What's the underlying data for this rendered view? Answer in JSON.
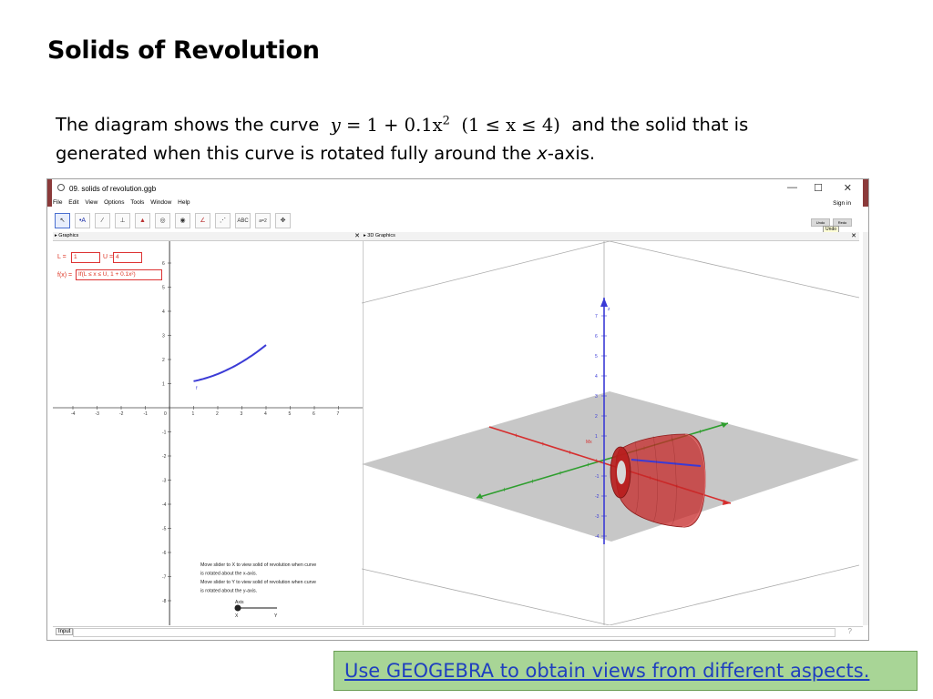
{
  "slide": {
    "title": "Solids of Revolution",
    "desc_before": "The diagram shows the curve",
    "eq_y": "y",
    "eq_main": " = 1 + 0.1x",
    "eq_exp": "2",
    "eq_domain": "(1 ≤ x ≤ 4)",
    "desc_after": "and the solid that is",
    "desc_line2_a": "generated when this curve is rotated fully around the ",
    "desc_line2_x": "x",
    "desc_line2_b": "-axis.",
    "footer_link": "Use GEOGEBRA to obtain views from different aspects."
  },
  "window": {
    "title": "09. solids of revolution.ggb",
    "minimize": "—",
    "maximize": "☐",
    "close": "✕",
    "menus": [
      "File",
      "Edit",
      "View",
      "Options",
      "Tools",
      "Window",
      "Help"
    ],
    "signin": "Sign in",
    "undo_tooltip": "Undo",
    "undo_btn": "Undo",
    "redo_btn": "Redo",
    "tool_abc": "ABC",
    "tool_slider": "a=2"
  },
  "panels": {
    "graphics": "Graphics",
    "graphics3d": "3D Graphics",
    "close_icon": "✕"
  },
  "algebra": {
    "L_label": "L =",
    "L_value": "1",
    "U_label": "U =",
    "U_value": "4",
    "f_label": "f(x) =",
    "f_value": "If(L ≤ x ≤ U, 1 + 0.1x²)"
  },
  "graph2d": {
    "x_ticks": [
      "-4",
      "-3",
      "-2",
      "-1",
      "0",
      "1",
      "2",
      "3",
      "4",
      "5",
      "6",
      "7"
    ],
    "y_ticks_pos": [
      "6",
      "5",
      "4",
      "3",
      "2",
      "1"
    ],
    "y_ticks_neg": [
      "-1",
      "-2",
      "-3",
      "-4",
      "-5",
      "-6",
      "-7",
      "-8"
    ],
    "curve_label": "f",
    "instructions": [
      "Move slider to X to view solid of revolution when curve",
      "is rotated about the x-axis.",
      "Move slider to Y to view solid of revolution when curve",
      "is rotated about the y-axis."
    ],
    "slider_label": "Axis",
    "slider_x": "X",
    "slider_y": "Y",
    "curve_color": "#3b3bd6"
  },
  "graph3d": {
    "z_ticks": [
      "7",
      "6",
      "5",
      "4",
      "3",
      "2",
      "1",
      "-1",
      "-2",
      "-3",
      "-4"
    ],
    "z_label": "z",
    "label_mx": "Mx",
    "solid_color": "#c62828"
  },
  "inputbar": {
    "label": "Input",
    "help": "?"
  }
}
